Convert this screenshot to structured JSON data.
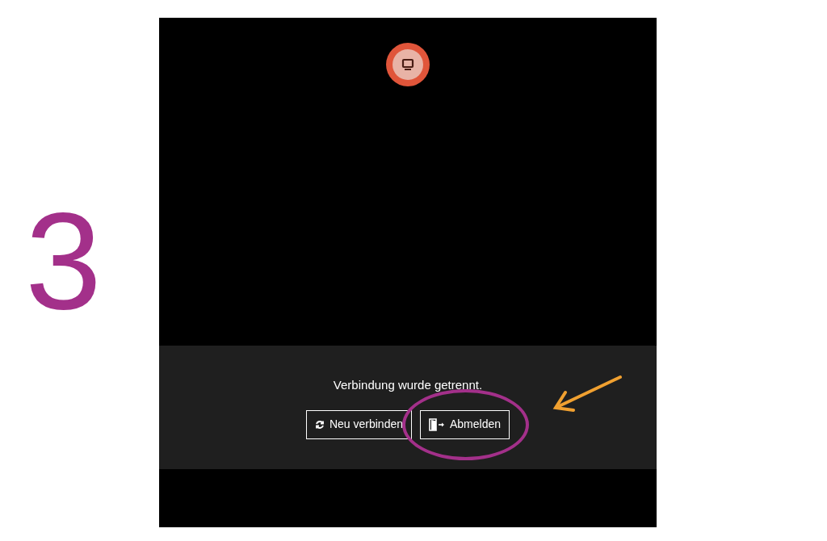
{
  "step_number": "3",
  "screen": {
    "message": "Verbindung wurde getrennt.",
    "buttons": [
      {
        "label": "Neu verbinden",
        "kind": "reconnect",
        "highlighted": false
      },
      {
        "label": "Abmelden",
        "kind": "logout",
        "highlighted": true
      }
    ]
  }
}
